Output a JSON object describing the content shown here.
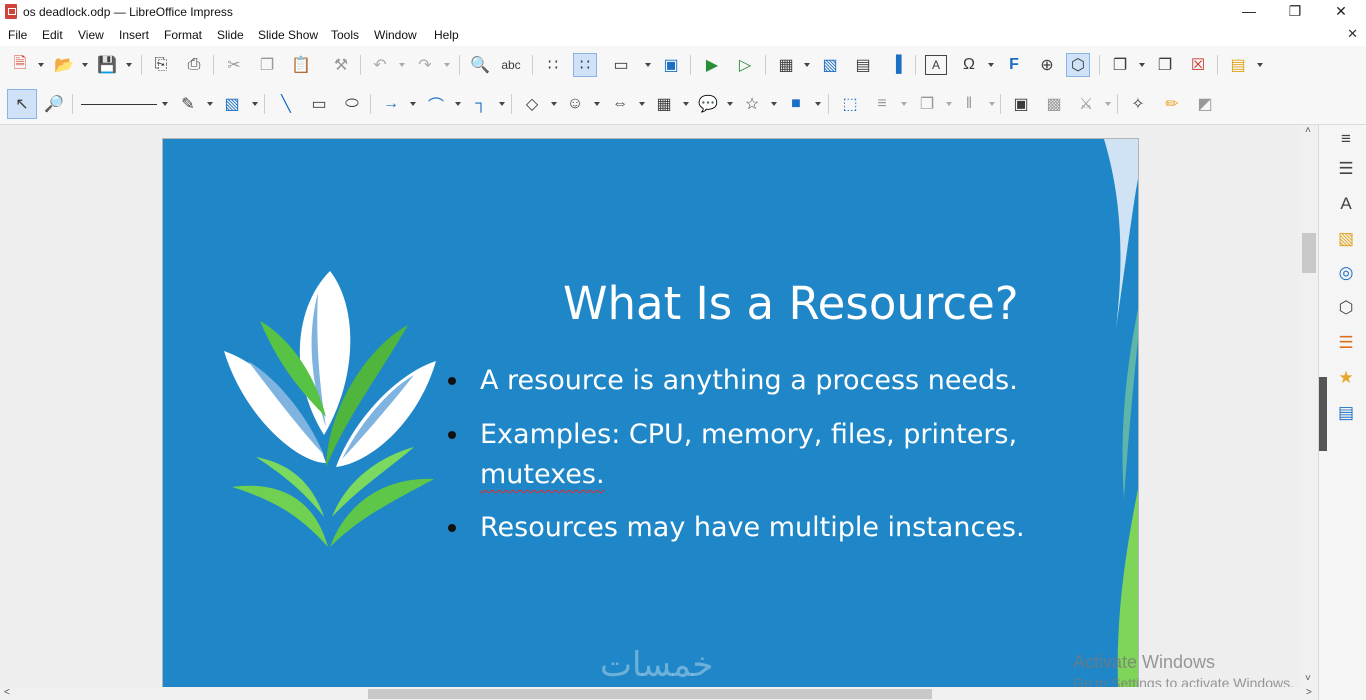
{
  "window": {
    "title": "os deadlock.odp — LibreOffice Impress",
    "controls": {
      "minimize": "—",
      "maximize": "❐",
      "close": "✕"
    }
  },
  "menubar": {
    "items": [
      "File",
      "Edit",
      "View",
      "Insert",
      "Format",
      "Slide",
      "Slide Show",
      "Tools",
      "Window",
      "Help"
    ],
    "close_document": "✕"
  },
  "toolbar1": {
    "icons": [
      {
        "name": "new-icon",
        "glyph": "🗎",
        "color": "#d9452f"
      },
      {
        "name": "open-icon",
        "glyph": "📂",
        "color": "#e2a21b"
      },
      {
        "name": "save-icon",
        "glyph": "💾",
        "color": "#7a2d8f"
      },
      {
        "name": "export-pdf-icon",
        "glyph": "⎘"
      },
      {
        "name": "print-icon",
        "glyph": "⎙"
      },
      {
        "name": "cut-icon",
        "glyph": "✂"
      },
      {
        "name": "copy-icon",
        "glyph": "❐"
      },
      {
        "name": "paste-icon",
        "glyph": "📋"
      },
      {
        "name": "clone-formatting-icon",
        "glyph": "⚒"
      },
      {
        "name": "undo-icon",
        "glyph": "↶"
      },
      {
        "name": "redo-icon",
        "glyph": "↷"
      },
      {
        "name": "find-replace-icon",
        "glyph": "🔍"
      },
      {
        "name": "spelling-icon",
        "glyph": "abc"
      },
      {
        "name": "display-grid-icon",
        "glyph": "∷"
      },
      {
        "name": "snap-to-grid-icon",
        "glyph": "∷"
      },
      {
        "name": "display-views-icon",
        "glyph": "▭"
      },
      {
        "name": "master-slide-icon",
        "glyph": "▣"
      },
      {
        "name": "start-from-first-icon",
        "glyph": "▶"
      },
      {
        "name": "start-from-current-icon",
        "glyph": "▷"
      },
      {
        "name": "insert-table-icon",
        "glyph": "▦"
      },
      {
        "name": "insert-image-icon",
        "glyph": "▧"
      },
      {
        "name": "insert-media-icon",
        "glyph": "▤"
      },
      {
        "name": "insert-chart-icon",
        "glyph": "▐"
      },
      {
        "name": "insert-textbox-icon",
        "glyph": "A"
      },
      {
        "name": "special-character-icon",
        "glyph": "Ω"
      },
      {
        "name": "fontwork-icon",
        "glyph": "F"
      },
      {
        "name": "hyperlink-icon",
        "glyph": "⊕"
      },
      {
        "name": "show-draw-functions-icon",
        "glyph": "⬡"
      },
      {
        "name": "new-slide-icon",
        "glyph": "❐"
      },
      {
        "name": "duplicate-slide-icon",
        "glyph": "❐"
      },
      {
        "name": "delete-slide-icon",
        "glyph": "☒"
      },
      {
        "name": "slide-layout-icon",
        "glyph": "▤"
      }
    ]
  },
  "toolbar2": {
    "icons": [
      {
        "name": "select-icon",
        "glyph": "↖"
      },
      {
        "name": "zoom-pan-icon",
        "glyph": "🔎"
      },
      {
        "name": "line-style-icon",
        "glyph": "─"
      },
      {
        "name": "line-color-icon",
        "glyph": "✎",
        "color": "#000000"
      },
      {
        "name": "fill-color-icon",
        "glyph": "▧",
        "color": "#1b6fc4"
      },
      {
        "name": "line-icon",
        "glyph": "╲"
      },
      {
        "name": "rectangle-icon",
        "glyph": "▭"
      },
      {
        "name": "ellipse-icon",
        "glyph": "⬭"
      },
      {
        "name": "lines-arrows-icon",
        "glyph": "→"
      },
      {
        "name": "curves-icon",
        "glyph": "⌒"
      },
      {
        "name": "connectors-icon",
        "glyph": "┐"
      },
      {
        "name": "basic-shapes-icon",
        "glyph": "◇"
      },
      {
        "name": "symbol-shapes-icon",
        "glyph": "☺"
      },
      {
        "name": "block-arrows-icon",
        "glyph": "⇔"
      },
      {
        "name": "flowchart-icon",
        "glyph": "▦"
      },
      {
        "name": "callouts-icon",
        "glyph": "💬"
      },
      {
        "name": "stars-icon",
        "glyph": "☆"
      },
      {
        "name": "3d-objects-icon",
        "glyph": "■",
        "color": "#1b6fc4"
      },
      {
        "name": "points-icon",
        "glyph": "⬚"
      },
      {
        "name": "align-icon",
        "glyph": "≡"
      },
      {
        "name": "arrange-icon",
        "glyph": "❐"
      },
      {
        "name": "distribute-icon",
        "glyph": "‖"
      },
      {
        "name": "shadow-icon",
        "glyph": "▣"
      },
      {
        "name": "crop-image-icon",
        "glyph": "▩"
      },
      {
        "name": "filter-icon",
        "glyph": "⚔"
      },
      {
        "name": "transformations-icon",
        "glyph": "✧"
      },
      {
        "name": "glue-points-icon",
        "glyph": "✏",
        "color": "#e9a52a"
      },
      {
        "name": "toggle-extrusion-icon",
        "glyph": "◩"
      }
    ]
  },
  "slide": {
    "title": "What Is a Resource?",
    "bullets": [
      {
        "line1": "A resource is anything a process needs.",
        "line2": ""
      },
      {
        "line1": "Examples: CPU, memory, files, printers,",
        "line2": "mutexes."
      },
      {
        "line1": "Resources may have multiple instances.",
        "line2": ""
      }
    ],
    "background_color": "#1f87c7",
    "logo_colors": {
      "leaf_white": "#ffffff",
      "leaf_green": "#58c244",
      "leaf_blue": "#7fb4e0"
    }
  },
  "watermark_logo_text": "خمسات",
  "activation": {
    "line1": "Activate Windows",
    "line2": "Go to Settings to activate Windows."
  },
  "scrollbars": {
    "up": "˄",
    "down": "˅",
    "left": "<",
    "right": ">"
  },
  "sidebar": {
    "icons": [
      {
        "name": "sidebar-menu-icon",
        "glyph": "≡"
      },
      {
        "name": "properties-icon",
        "glyph": "☰"
      },
      {
        "name": "styles-icon",
        "glyph": "A"
      },
      {
        "name": "gallery-icon",
        "glyph": "▧"
      },
      {
        "name": "navigator-icon",
        "glyph": "◎"
      },
      {
        "name": "shapes-icon",
        "glyph": "⬡"
      },
      {
        "name": "slide-transition-icon",
        "glyph": "☰"
      },
      {
        "name": "animation-icon",
        "glyph": "★"
      },
      {
        "name": "master-slides-icon",
        "glyph": "▤"
      }
    ]
  }
}
